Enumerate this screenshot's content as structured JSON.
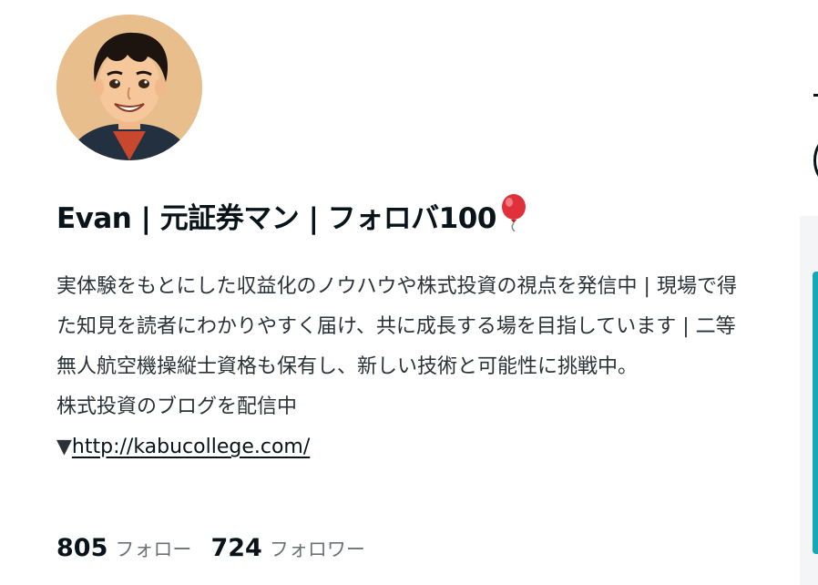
{
  "profile": {
    "avatar_alt": "profile avatar",
    "name": "Evan | 元証券マン | フォロバ100",
    "name_emoji_icon": "balloon-icon",
    "bio": {
      "para1": "実体験をもとにした収益化のノウハウや株式投資の視点を発信中 | 現場で得た知見を読者にわかりやすく届け、共に成長する場を目指しています | 二等無人航空機操縦士資格も保有し、新しい技術と可能性に挑戦中。",
      "para2": "株式投資のブログを配信中",
      "link_prefix": "▼",
      "link_text": "http://kabucollege.com/"
    },
    "stats": {
      "following_count": "805",
      "following_label": "フォロー",
      "followers_count": "724",
      "followers_label": "フォロワー"
    }
  },
  "colors": {
    "text": "#08131a",
    "muted": "#6b7275",
    "accent": "#14a8b8",
    "balloon": "#e0303a"
  }
}
